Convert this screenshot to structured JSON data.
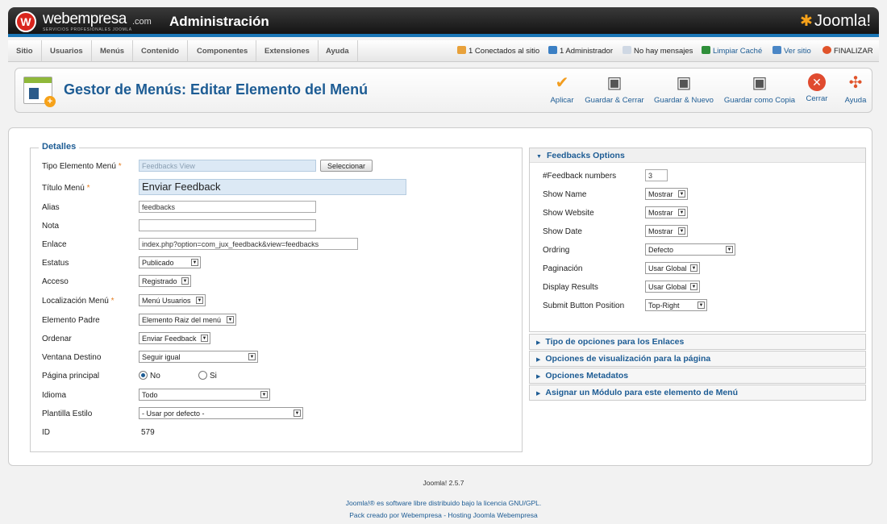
{
  "header": {
    "logo_letter": "W",
    "brand": "webempresa",
    "brand_suffix": ".com",
    "brand_tagline": "SERVICIOS PROFESIONALES JOOMLA",
    "title": "Administración",
    "joomla_logo": "Joomla!"
  },
  "menu": [
    "Sitio",
    "Usuarios",
    "Menús",
    "Contenido",
    "Componentes",
    "Extensiones",
    "Ayuda"
  ],
  "status": {
    "connected": "1 Conectados al sitio",
    "admins": "1 Administrador",
    "messages": "No hay mensajes",
    "clear_cache": "Limpiar Caché",
    "view_site": "Ver sitio",
    "logout": "FINALIZAR"
  },
  "toolbar": {
    "title": "Gestor de Menús: Editar Elemento del Menú",
    "apply": "Aplicar",
    "save_close": "Guardar & Cerrar",
    "save_new": "Guardar & Nuevo",
    "save_copy": "Guardar como Copia",
    "close": "Cerrar",
    "help": "Ayuda"
  },
  "details": {
    "legend": "Detalles",
    "type_label": "Tipo Elemento Menú",
    "type_value": "Feedbacks View",
    "select_button": "Seleccionar",
    "title_label": "Título Menú",
    "title_value": "Enviar Feedback",
    "alias_label": "Alias",
    "alias_value": "feedbacks",
    "note_label": "Nota",
    "note_value": "",
    "link_label": "Enlace",
    "link_value": "index.php?option=com_jux_feedback&view=feedbacks",
    "status_label": "Estatus",
    "status_value": "Publicado",
    "access_label": "Acceso",
    "access_value": "Registrado",
    "location_label": "Localización Menú",
    "location_value": "Menú Usuarios",
    "parent_label": "Elemento Padre",
    "parent_value": "Elemento Raiz del menú",
    "order_label": "Ordenar",
    "order_value": "Enviar Feedback",
    "target_label": "Ventana Destino",
    "target_value": "Seguir igual",
    "home_label": "Página principal",
    "home_no": "No",
    "home_yes": "Si",
    "lang_label": "Idioma",
    "lang_value": "Todo",
    "template_label": "Plantilla Estilo",
    "template_value": "- Usar por defecto -",
    "id_label": "ID",
    "id_value": "579"
  },
  "feedback_options": {
    "title": "Feedbacks Options",
    "numbers_label": "#Feedback numbers",
    "numbers_value": "3",
    "show_name_label": "Show Name",
    "show_name_value": "Mostrar",
    "show_website_label": "Show Website",
    "show_website_value": "Mostrar",
    "show_date_label": "Show Date",
    "show_date_value": "Mostrar",
    "ordering_label": "Ordring",
    "ordering_value": "Defecto",
    "pagination_label": "Paginación",
    "pagination_value": "Usar Global",
    "display_label": "Display Results",
    "display_value": "Usar Global",
    "submit_label": "Submit Button Position",
    "submit_value": "Top-Right"
  },
  "panels": {
    "links": "Tipo de opciones para los Enlaces",
    "page_display": "Opciones de visualización para la página",
    "metadata": "Opciones Metadatos",
    "module": "Asignar un Módulo para este elemento de Menú"
  },
  "footer": {
    "version": "Joomla! 2.5.7",
    "license": "Joomla!® es software libre distribuido bajo la licencia GNU/GPL.",
    "pack": "Pack creado por Webempresa - Hosting Joomla Webempresa"
  }
}
